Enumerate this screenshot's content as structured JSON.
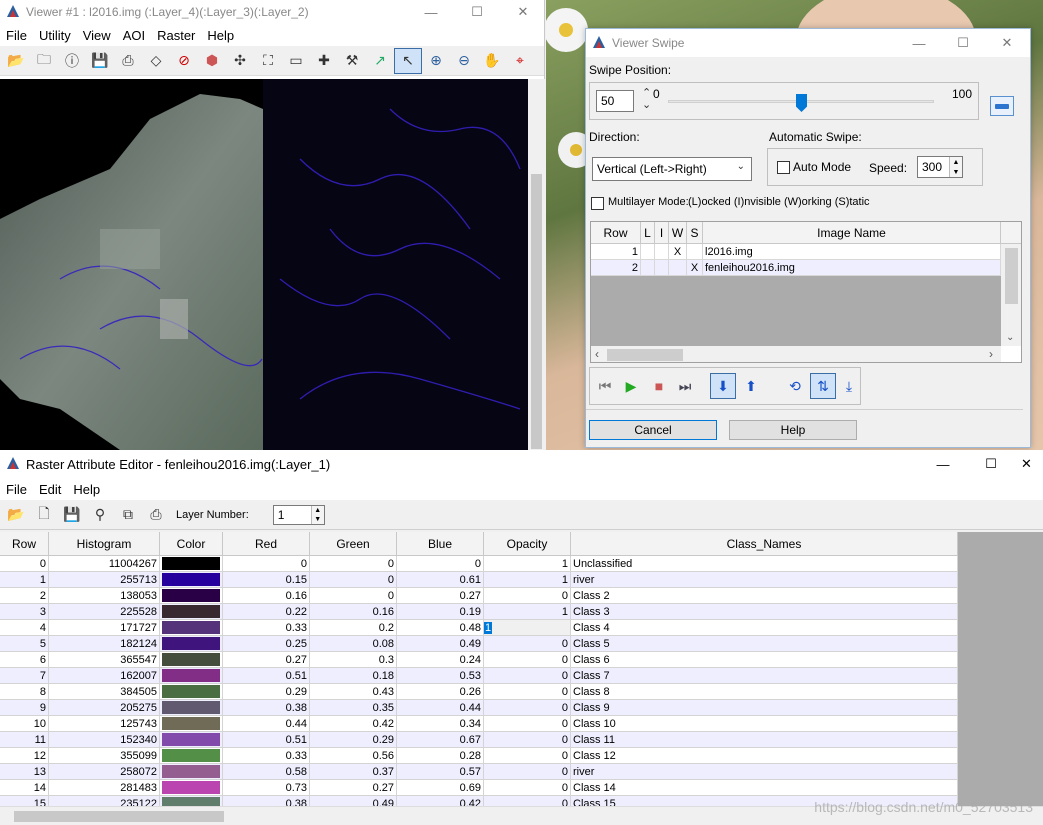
{
  "viewer": {
    "title": "Viewer #1 : l2016.img (:Layer_4)(:Layer_3)(:Layer_2)",
    "menu": [
      "File",
      "Utility",
      "View",
      "AOI",
      "Raster",
      "Help"
    ],
    "toolbar_icons": [
      "open-icon",
      "open-layer-icon",
      "info-icon",
      "save-icon",
      "print-icon",
      "eraser-icon",
      "clear-icon",
      "fill-icon",
      "fit-icon",
      "fullscreen-icon",
      "measure-icon",
      "crosshair-icon",
      "inquire-icon",
      "profile-icon",
      "select-icon",
      "zoom-in-icon",
      "zoom-out-icon",
      "pan-icon",
      "pick-icon"
    ],
    "window_controls": {
      "min": "—",
      "max": "☐",
      "close": "✕"
    }
  },
  "swipe": {
    "title": "Viewer Swipe",
    "window_controls": {
      "min": "—",
      "max": "☐",
      "close": "✕"
    },
    "position_label": "Swipe Position:",
    "position_value": "50",
    "slider_min": "0",
    "slider_max": "100",
    "slider_level": 0.5,
    "direction_label": "Direction:",
    "direction_value": "Vertical (Left->Right)",
    "auto_swipe_label": "Automatic Swipe:",
    "auto_mode_label": "Auto Mode",
    "speed_label": "Speed:",
    "speed_value": "300",
    "multilayer_label": "Multilayer Mode:",
    "multilayer_legend": "(L)ocked (I)nvisible (W)orking (S)tatic",
    "grid": {
      "headers": [
        "Row",
        "L",
        "I",
        "W",
        "S",
        "Image Name"
      ],
      "rows": [
        {
          "row": "1",
          "l": "",
          "i": "",
          "w": "X",
          "s": "",
          "name": "l2016.img"
        },
        {
          "row": "2",
          "l": "",
          "i": "",
          "w": "",
          "s": "X",
          "name": "fenleihou2016.img"
        }
      ]
    },
    "cancel_label": "Cancel",
    "help_label": "Help"
  },
  "rae": {
    "title": "Raster Attribute Editor - fenleihou2016.img(:Layer_1)",
    "window_controls": {
      "min": "—",
      "max": "☐",
      "close": "✕"
    },
    "menu": [
      "File",
      "Edit",
      "Help"
    ],
    "layer_number_label": "Layer Number:",
    "layer_number_value": "1",
    "headers": [
      "Row",
      "Histogram",
      "Color",
      "Red",
      "Green",
      "Blue",
      "Opacity",
      "Class_Names"
    ],
    "rows": [
      {
        "row": "0",
        "hist": "11004267",
        "color": "#000000",
        "red": "0",
        "green": "0",
        "blue": "0",
        "opacity": "1",
        "name": "Unclassified"
      },
      {
        "row": "1",
        "hist": "255713",
        "color": "#26009c",
        "red": "0.15",
        "green": "0",
        "blue": "0.61",
        "opacity": "1",
        "name": "river"
      },
      {
        "row": "2",
        "hist": "138053",
        "color": "#290045",
        "red": "0.16",
        "green": "0",
        "blue": "0.27",
        "opacity": "0",
        "name": "Class 2"
      },
      {
        "row": "3",
        "hist": "225528",
        "color": "#382930",
        "red": "0.22",
        "green": "0.16",
        "blue": "0.19",
        "opacity": "1",
        "name": "Class 3"
      },
      {
        "row": "4",
        "hist": "171727",
        "color": "#54337b",
        "red": "0.33",
        "green": "0.2",
        "blue": "0.48",
        "opacity": "1",
        "name": "Class 4"
      },
      {
        "row": "5",
        "hist": "182124",
        "color": "#40147d",
        "red": "0.25",
        "green": "0.08",
        "blue": "0.49",
        "opacity": "0",
        "name": "Class 5"
      },
      {
        "row": "6",
        "hist": "365547",
        "color": "#454d3d",
        "red": "0.27",
        "green": "0.3",
        "blue": "0.24",
        "opacity": "0",
        "name": "Class 6"
      },
      {
        "row": "7",
        "hist": "162007",
        "color": "#822e87",
        "red": "0.51",
        "green": "0.18",
        "blue": "0.53",
        "opacity": "0",
        "name": "Class 7"
      },
      {
        "row": "8",
        "hist": "384505",
        "color": "#4a6e42",
        "red": "0.29",
        "green": "0.43",
        "blue": "0.26",
        "opacity": "0",
        "name": "Class 8"
      },
      {
        "row": "9",
        "hist": "205275",
        "color": "#615970",
        "red": "0.38",
        "green": "0.35",
        "blue": "0.44",
        "opacity": "0",
        "name": "Class 9"
      },
      {
        "row": "10",
        "hist": "125743",
        "color": "#706b57",
        "red": "0.44",
        "green": "0.42",
        "blue": "0.34",
        "opacity": "0",
        "name": "Class 10"
      },
      {
        "row": "11",
        "hist": "152340",
        "color": "#824aab",
        "red": "0.51",
        "green": "0.29",
        "blue": "0.67",
        "opacity": "0",
        "name": "Class 11"
      },
      {
        "row": "12",
        "hist": "355099",
        "color": "#548f47",
        "red": "0.33",
        "green": "0.56",
        "blue": "0.28",
        "opacity": "0",
        "name": "Class 12"
      },
      {
        "row": "13",
        "hist": "258072",
        "color": "#945e91",
        "red": "0.58",
        "green": "0.37",
        "blue": "0.57",
        "opacity": "0",
        "name": "river"
      },
      {
        "row": "14",
        "hist": "281483",
        "color": "#ba45b0",
        "red": "0.73",
        "green": "0.27",
        "blue": "0.69",
        "opacity": "0",
        "name": "Class 14"
      },
      {
        "row": "15",
        "hist": "235122",
        "color": "#617d6b",
        "red": "0.38",
        "green": "0.49",
        "blue": "0.42",
        "opacity": "0",
        "name": "Class 15"
      }
    ]
  },
  "watermark": "https://blog.csdn.net/m0_52703513"
}
